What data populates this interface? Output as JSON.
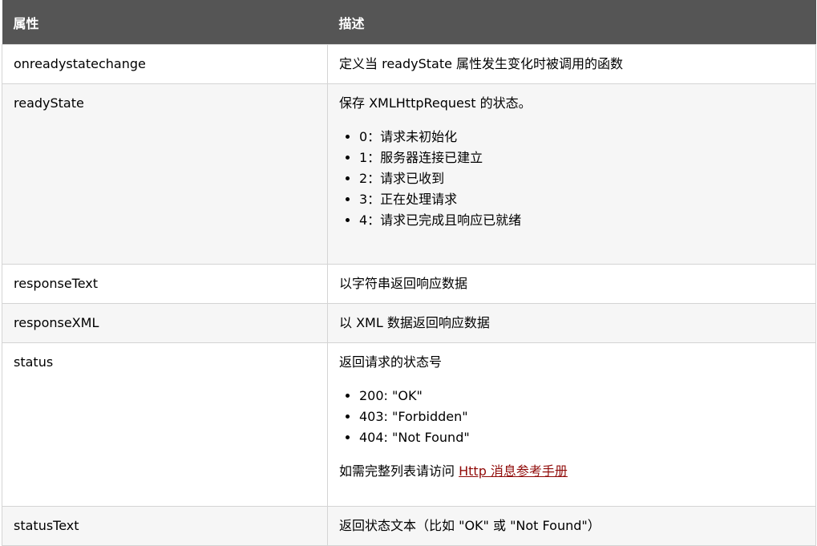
{
  "table": {
    "header": {
      "property": "属性",
      "description": "描述"
    },
    "rows": [
      {
        "property": "onreadystatechange",
        "description": "定义当 readyState 属性发生变化时被调用的函数"
      },
      {
        "property": "readyState",
        "description": "保存 XMLHttpRequest 的状态。",
        "items": [
          "0：请求未初始化",
          "1：服务器连接已建立",
          "2：请求已收到",
          "3：正在处理请求",
          "4：请求已完成且响应已就绪"
        ]
      },
      {
        "property": "responseText",
        "description": "以字符串返回响应数据"
      },
      {
        "property": "responseXML",
        "description": "以 XML 数据返回响应数据"
      },
      {
        "property": "status",
        "description": "返回请求的状态号",
        "items": [
          "200: \"OK\"",
          "403: \"Forbidden\"",
          "404: \"Not Found\""
        ],
        "footer_text": "如需完整列表请访问",
        "footer_link": "Http 消息参考手册"
      },
      {
        "property": "statusText",
        "description": "返回状态文本（比如 \"OK\" 或 \"Not Found\"）"
      }
    ]
  },
  "colors": {
    "header_bg": "#555555",
    "header_text": "#ffffff",
    "row_alt_bg": "#f6f6f6",
    "border": "#d4d4d4",
    "link": "#900b09"
  }
}
